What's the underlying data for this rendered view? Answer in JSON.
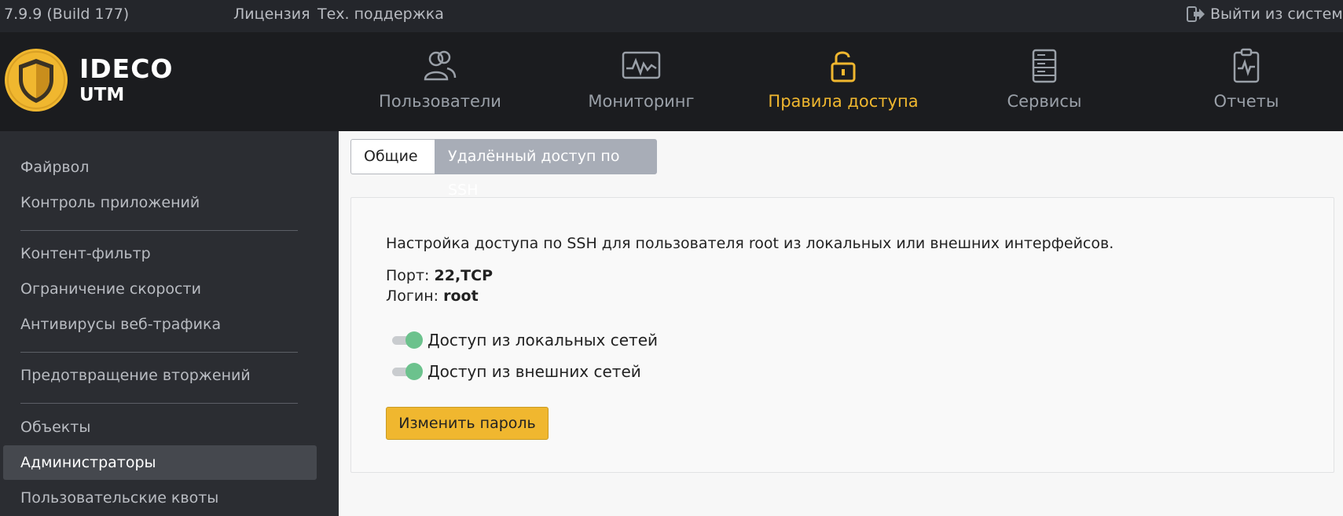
{
  "topbar": {
    "version": "7.9.9 (Build 177)",
    "license_link": "Лицензия",
    "support_link": "Тех. поддержка",
    "logout": "Выйти из системы",
    "logout_icon": "logout-icon"
  },
  "brand": {
    "line1": "IDECO",
    "line2": "UTM",
    "logo_icon": "shield-logo"
  },
  "nav": {
    "users": {
      "label": "Пользователи",
      "icon": "users-icon"
    },
    "monitoring": {
      "label": "Мониторинг",
      "icon": "monitor-icon"
    },
    "access_rules": {
      "label": "Правила доступа",
      "icon": "lock-icon",
      "active": true
    },
    "services": {
      "label": "Сервисы",
      "icon": "server-icon"
    },
    "reports": {
      "label": "Отчеты",
      "icon": "clipboard-icon"
    }
  },
  "sidebar": {
    "items": [
      "Файрвол",
      "Контроль приложений",
      "Контент-фильтр",
      "Ограничение скорости",
      "Антивирусы веб-трафика",
      "Предотвращение вторжений",
      "Объекты",
      "Администраторы",
      "Пользовательские квоты"
    ],
    "active_index": 7
  },
  "tabs": {
    "general": "Общие",
    "ssh": "Удалённый доступ по SSH",
    "active": "ssh"
  },
  "panel": {
    "description": "Настройка доступа по SSH для пользователя root из локальных или внешних интерфейсов.",
    "port_label": "Порт:",
    "port_value": "22,TCP",
    "login_label": "Логин:",
    "login_value": "root",
    "toggle_local": {
      "label": "Доступ из локальных сетей",
      "on": true
    },
    "toggle_external": {
      "label": "Доступ из внешних сетей",
      "on": true
    },
    "change_password": "Изменить пароль"
  },
  "colors": {
    "accent": "#f0b72f",
    "toggle_on": "#6cc28d",
    "header_bg": "#1b1c1f",
    "sidebar_bg": "#2b2d32"
  }
}
